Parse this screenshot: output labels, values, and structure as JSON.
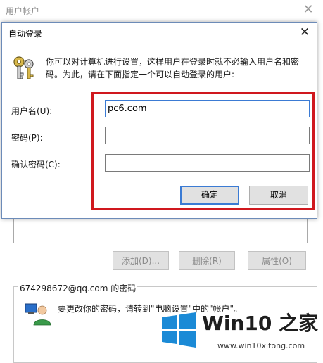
{
  "background_window": {
    "title": "用户帐户",
    "buttons": {
      "add": "添加(D)...",
      "delete": "删除(R)",
      "properties": "属性(O)"
    },
    "password_group_title": "674298672@qq.com 的密码",
    "password_text": "要更改你的密码，请转到\"电脑设置\"中的\"帐户\"。"
  },
  "dialog": {
    "title": "自动登录",
    "message": "你可以对计算机进行设置，这样用户在登录时就不必输入用户名和密码。为此，请在下面指定一个可以自动登录的用户:",
    "fields": {
      "username_label": "用户名(U):",
      "username_value": "pc6.com",
      "password_label": "密码(P):",
      "password_value": "",
      "confirm_label": "确认密码(C):",
      "confirm_value": ""
    },
    "buttons": {
      "ok": "确定",
      "cancel": "取消"
    }
  },
  "watermark": {
    "brand": "Win10 之家",
    "url": "www.win10xitong.com"
  },
  "colors": {
    "highlight": "#d0181e",
    "accent": "#3b7bd4",
    "logo_blue": "#1b8ad6"
  },
  "icons": [
    "close-icon",
    "key-icon",
    "user-icon",
    "windows-logo-icon"
  ]
}
